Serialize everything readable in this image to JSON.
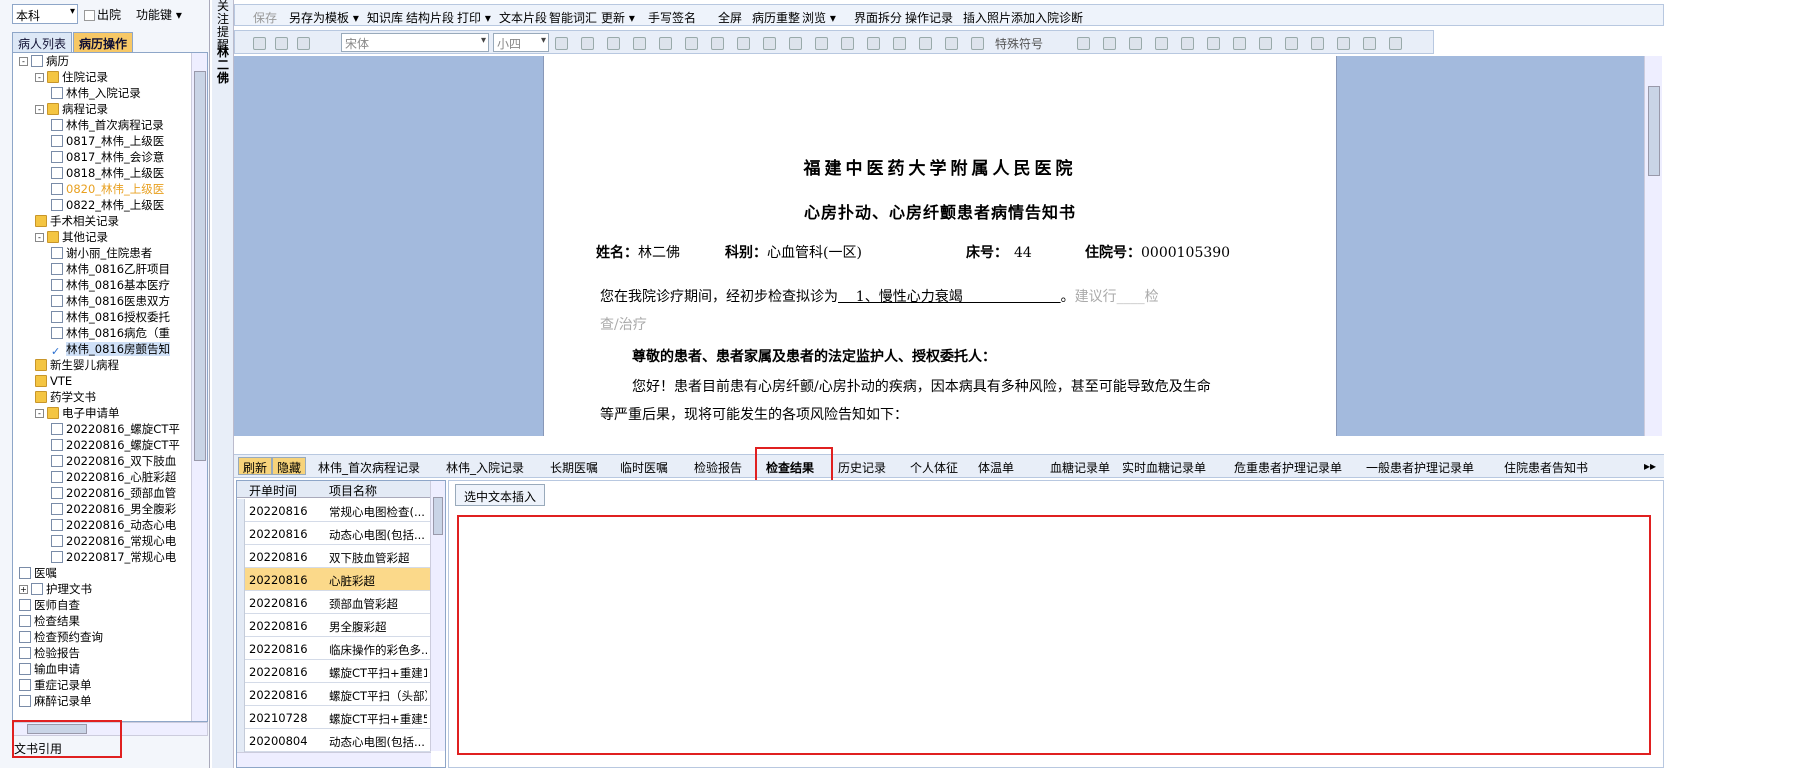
{
  "left": {
    "dept": "本科",
    "discharged_label": "出院",
    "function_key": "功能键",
    "tabs": [
      "病人列表",
      "病历操作"
    ],
    "tree": [
      {
        "label": "病历",
        "indent": 0,
        "icon": "doc",
        "exp": "-"
      },
      {
        "label": "住院记录",
        "indent": 1,
        "icon": "fold",
        "exp": "-"
      },
      {
        "label": "林伟_入院记录",
        "indent": 2,
        "icon": "doc"
      },
      {
        "label": "病程记录",
        "indent": 1,
        "icon": "fold",
        "exp": "-"
      },
      {
        "label": "林伟_首次病程记录",
        "indent": 2,
        "icon": "doc"
      },
      {
        "label": "0817_林伟_上级医",
        "indent": 2,
        "icon": "doc"
      },
      {
        "label": "0817_林伟_会诊意",
        "indent": 2,
        "icon": "doc"
      },
      {
        "label": "0818_林伟_上级医",
        "indent": 2,
        "icon": "doc"
      },
      {
        "label": "0820_林伟_上级医",
        "indent": 2,
        "icon": "doc",
        "orange": true
      },
      {
        "label": "0822_林伟_上级医",
        "indent": 2,
        "icon": "doc"
      },
      {
        "label": "手术相关记录",
        "indent": 1,
        "icon": "fold"
      },
      {
        "label": "其他记录",
        "indent": 1,
        "icon": "fold",
        "exp": "-"
      },
      {
        "label": "谢小丽_住院患者",
        "indent": 2,
        "icon": "doc"
      },
      {
        "label": "林伟_0816乙肝项目",
        "indent": 2,
        "icon": "doc"
      },
      {
        "label": "林伟_0816基本医疗",
        "indent": 2,
        "icon": "doc"
      },
      {
        "label": "林伟_0816医患双方",
        "indent": 2,
        "icon": "doc"
      },
      {
        "label": "林伟_0816授权委托",
        "indent": 2,
        "icon": "doc"
      },
      {
        "label": "林伟_0816病危（重",
        "indent": 2,
        "icon": "doc"
      },
      {
        "label": "林伟_0816房颤告知",
        "indent": 2,
        "icon": "check",
        "sel": true
      },
      {
        "label": "新生婴儿病程",
        "indent": 1,
        "icon": "fold"
      },
      {
        "label": "VTE",
        "indent": 1,
        "icon": "fold"
      },
      {
        "label": "药学文书",
        "indent": 1,
        "icon": "fold"
      },
      {
        "label": "电子申请单",
        "indent": 1,
        "icon": "fold",
        "exp": "-"
      },
      {
        "label": "20220816_螺旋CT平",
        "indent": 2,
        "icon": "doc"
      },
      {
        "label": "20220816_螺旋CT平",
        "indent": 2,
        "icon": "doc"
      },
      {
        "label": "20220816_双下肢血",
        "indent": 2,
        "icon": "doc"
      },
      {
        "label": "20220816_心脏彩超",
        "indent": 2,
        "icon": "doc"
      },
      {
        "label": "20220816_颈部血管",
        "indent": 2,
        "icon": "doc"
      },
      {
        "label": "20220816_男全腹彩",
        "indent": 2,
        "icon": "doc"
      },
      {
        "label": "20220816_动态心电",
        "indent": 2,
        "icon": "doc"
      },
      {
        "label": "20220816_常规心电",
        "indent": 2,
        "icon": "doc"
      },
      {
        "label": "20220817_常规心电",
        "indent": 2,
        "icon": "doc"
      },
      {
        "label": "医嘱",
        "indent": 0,
        "icon": "doc"
      },
      {
        "label": "护理文书",
        "indent": 0,
        "icon": "doc",
        "exp": "+"
      },
      {
        "label": "医师自查",
        "indent": 0,
        "icon": "doc"
      },
      {
        "label": "检查结果",
        "indent": 0,
        "icon": "doc"
      },
      {
        "label": "检查预约查询",
        "indent": 0,
        "icon": "doc"
      },
      {
        "label": "检验报告",
        "indent": 0,
        "icon": "doc"
      },
      {
        "label": "输血申请",
        "indent": 0,
        "icon": "doc"
      },
      {
        "label": "重症记录单",
        "indent": 0,
        "icon": "doc"
      },
      {
        "label": "麻醉记录单",
        "indent": 0,
        "icon": "doc"
      }
    ],
    "doc_ref": "文书引用"
  },
  "strip": {
    "reminder": "关注提醒",
    "patient": "林二佛"
  },
  "menu": {
    "save": "保存",
    "items": [
      "另存为模板 ▾",
      "知识库",
      "结构片段",
      "打印 ▾",
      "文本片段",
      "智能词汇",
      "更新 ▾",
      "手写签名",
      "全屏",
      "病历重整",
      "浏览 ▾",
      "界面拆分",
      "操作记录",
      "插入照片",
      "添加入院诊断"
    ]
  },
  "toolbar": {
    "font": "宋体",
    "size": "小四",
    "special_chars": "特殊符号"
  },
  "document": {
    "hospital": "福建中医药大学附属人民医院",
    "doc_title": "心房扑动、心房纤颤患者病情告知书",
    "name_label": "姓名：",
    "name": "林二佛",
    "dept_label": "科别：",
    "dept": "心血管科(一区)",
    "bed_label": "床号：",
    "bed": "44",
    "admission_label": "住院号：",
    "admission": "0000105390",
    "p1_prefix": "您在我院诊疗期间，经初步检查拟诊为",
    "diagnosis": "    1、慢性心力衰竭                      ",
    "p1_suffix": "。",
    "p1_gray": "建议行____检",
    "p1_line2_gray": "查/治疗",
    "p2": "尊敬的患者、患者家属及患者的法定监护人、授权委托人：",
    "p3_line1": "您好！患者目前患有心房纤颤/心房扑动的疾病，因本病具有多种风险，甚至可能导致危及生命",
    "p3_line2": "等严重后果，现将可能发生的各项风险告知如下："
  },
  "bottom_tabs": {
    "refresh": "刷新",
    "hide": "隐藏",
    "tabs": [
      "林伟_首次病程记录",
      "林伟_入院记录",
      "长期医嘱",
      "临时医嘱",
      "检验报告",
      "检查结果",
      "历史记录",
      "个人体征",
      "体温单",
      "血糖记录单",
      "实时血糖记录单",
      "危重患者护理记录单",
      "一般患者护理记录单",
      "住院患者告知书"
    ],
    "active": "检查结果",
    "more": "▸▸"
  },
  "table": {
    "headers": [
      "开单时间",
      "项目名称"
    ],
    "rows": [
      [
        "20220816",
        "常规心电图检查(..."
      ],
      [
        "20220816",
        "动态心电图(包括..."
      ],
      [
        "20220816",
        "双下肢血管彩超"
      ],
      [
        "20220816",
        "心脏彩超"
      ],
      [
        "20220816",
        "颈部血管彩超"
      ],
      [
        "20220816",
        "男全腹彩超"
      ],
      [
        "20220816",
        "临床操作的彩色多..."
      ],
      [
        "20220816",
        "螺旋CT平扫+重建1..."
      ],
      [
        "20220816",
        "螺旋CT平扫（头部）"
      ],
      [
        "20210728",
        "螺旋CT平扫+重建5..."
      ],
      [
        "20200804",
        "动态心电图(包括..."
      ]
    ],
    "selected_index": 3
  },
  "insert_button": "选中文本插入"
}
